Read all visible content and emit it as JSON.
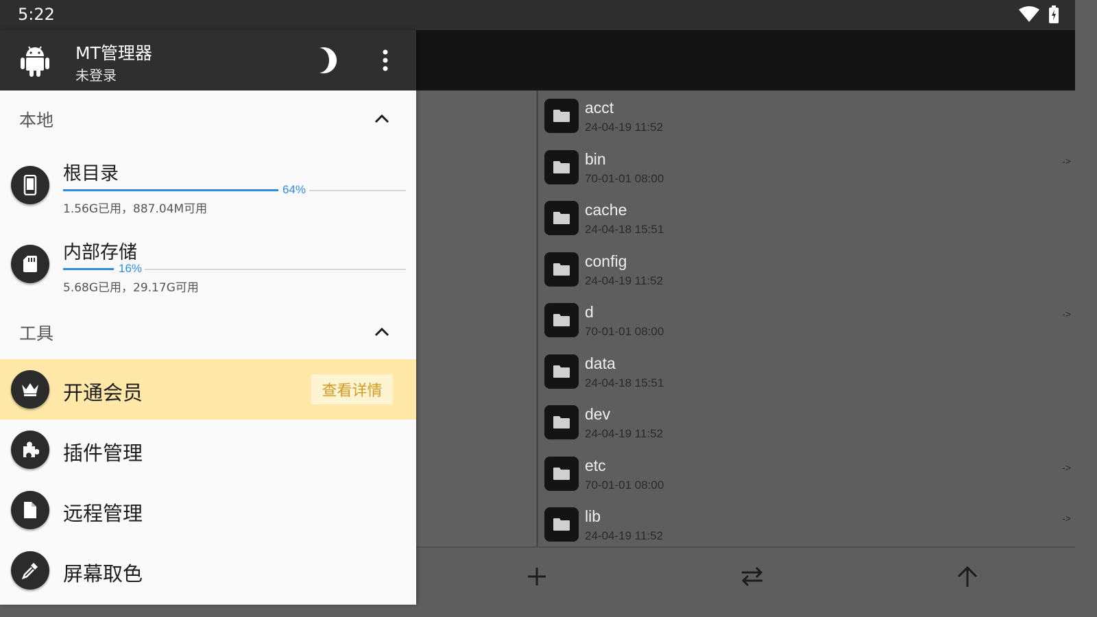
{
  "status_bar": {
    "time": "5:22",
    "icons": [
      "wifi-icon",
      "battery-charging-icon"
    ]
  },
  "drawer": {
    "app_name": "MT管理器",
    "login_status": "未登录",
    "sections": {
      "local": {
        "title": "本地",
        "items": [
          {
            "name": "根目录",
            "percent": "64%",
            "used_fraction": 0.64,
            "usage": "1.56G已用，887.04M可用",
            "icon": "phone-icon"
          },
          {
            "name": "内部存储",
            "percent": "16%",
            "used_fraction": 0.16,
            "usage": "5.68G已用，29.17G可用",
            "icon": "sd-card-icon"
          }
        ]
      },
      "tools": {
        "title": "工具",
        "items": [
          {
            "label": "开通会员",
            "icon": "crown-icon",
            "action_label": "查看详情"
          },
          {
            "label": "插件管理",
            "icon": "puzzle-icon"
          },
          {
            "label": "远程管理",
            "icon": "file-icon"
          },
          {
            "label": "屏幕取色",
            "icon": "eyedropper-icon"
          }
        ]
      }
    }
  },
  "files": [
    {
      "name": "acct",
      "date": "24-04-19 11:52",
      "link": ""
    },
    {
      "name": "bin",
      "date": "70-01-01 08:00",
      "link": "->"
    },
    {
      "name": "cache",
      "date": "24-04-18 15:51",
      "link": ""
    },
    {
      "name": "config",
      "date": "24-04-19 11:52",
      "link": ""
    },
    {
      "name": "d",
      "date": "70-01-01 08:00",
      "link": "->"
    },
    {
      "name": "data",
      "date": "24-04-18 15:51",
      "link": ""
    },
    {
      "name": "dev",
      "date": "24-04-19 11:52",
      "link": ""
    },
    {
      "name": "etc",
      "date": "70-01-01 08:00",
      "link": "->"
    },
    {
      "name": "lib",
      "date": "24-04-19 11:52",
      "link": "->"
    }
  ],
  "bottom_bar": {
    "icons": [
      "add-icon",
      "swap-icon",
      "arrow-up-icon"
    ]
  },
  "colors": {
    "accent": "#2d8ce6",
    "vip_background": "#ffe8a8",
    "vip_text": "#d49a22",
    "header": "#2f2f2f"
  }
}
